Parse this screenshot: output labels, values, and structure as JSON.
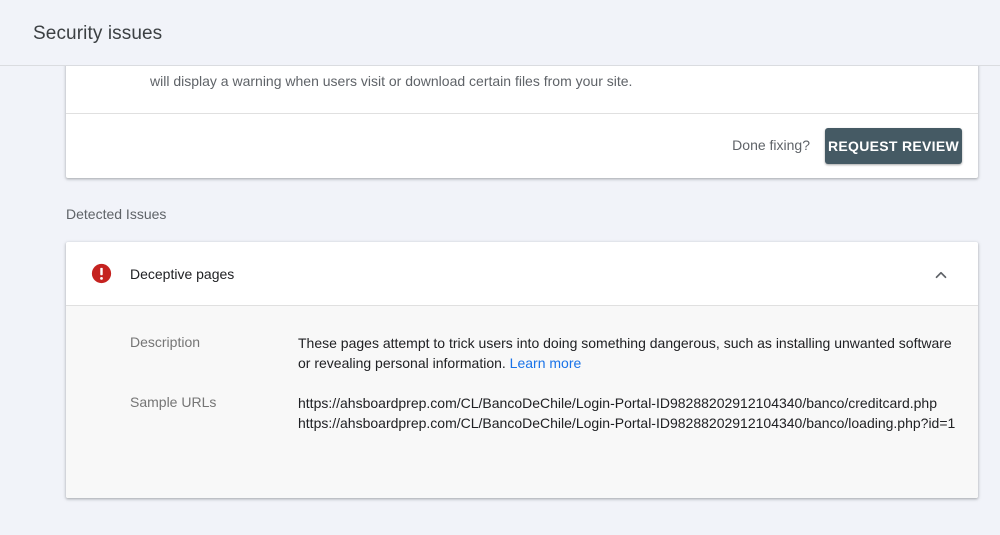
{
  "header": {
    "title": "Security issues"
  },
  "review_card": {
    "warning_text": "will display a warning when users visit or download certain files from your site.",
    "done_label": "Done fixing?",
    "request_button": "REQUEST REVIEW"
  },
  "detected_section": {
    "label": "Detected Issues"
  },
  "issue": {
    "icon": "error-icon",
    "icon_color": "#c5221f",
    "title": "Deceptive pages",
    "collapse_icon": "chevron-up-icon",
    "description_label": "Description",
    "description_text": "These pages attempt to trick users into doing something dangerous, such as installing unwanted software or revealing personal information.",
    "learn_more": "Learn more",
    "sample_urls_label": "Sample URLs",
    "sample_urls": [
      "https://ahsboardprep.com/CL/BancoDeChile/Login-Portal-ID98288202912104340/banco/creditcard.php",
      "https://ahsboardprep.com/CL/BancoDeChile/Login-Portal-ID98288202912104340/banco/loading.php?id=1"
    ]
  },
  "colors": {
    "page_bg": "#f1f3f9",
    "button_bg": "#455a64",
    "link": "#1a73e8"
  }
}
